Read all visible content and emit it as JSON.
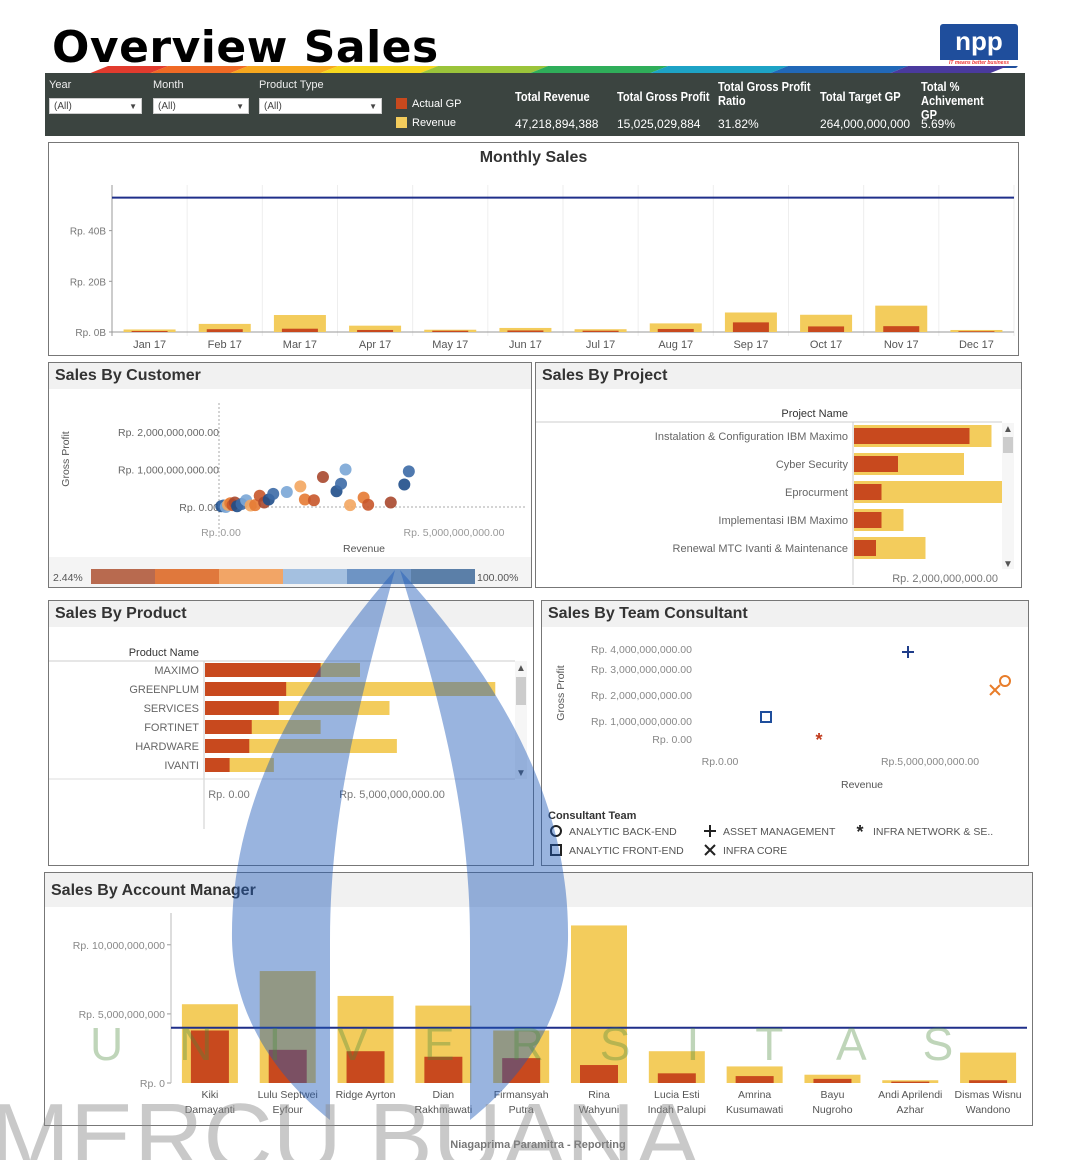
{
  "header": {
    "title": "Overview Sales",
    "logo_text": "npp",
    "logo_tagline": "IT means better business"
  },
  "filters": {
    "year": {
      "label": "Year",
      "value": "(All)"
    },
    "month": {
      "label": "Month",
      "value": "(All)"
    },
    "product_type": {
      "label": "Product Type",
      "value": "(All)"
    },
    "legend": [
      {
        "label": "Actual GP",
        "color": "#c8491e"
      },
      {
        "label": "Revenue",
        "color": "#f3cc5c"
      }
    ]
  },
  "kpis": [
    {
      "label": "Total Revenue",
      "value": "47,218,894,388"
    },
    {
      "label": "Total Gross Profit",
      "value": "15,025,029,884"
    },
    {
      "label": "Total Gross Profit Ratio",
      "value": "31.82%"
    },
    {
      "label": "Total Target GP",
      "value": "264,000,000,000"
    },
    {
      "label": "Total % Achivement GP",
      "value": "5.69%"
    }
  ],
  "monthly_sales": {
    "title": "Monthly Sales",
    "y_ticks": [
      "Rp. 40B",
      "Rp. 20B",
      "Rp. 0B"
    ],
    "chart_data": {
      "type": "bar",
      "categories": [
        "Jan 17",
        "Feb 17",
        "Mar 17",
        "Apr 17",
        "May 17",
        "Jun 17",
        "Jul 17",
        "Aug 17",
        "Sep 17",
        "Oct 17",
        "Nov 17",
        "Dec 17"
      ],
      "series": [
        {
          "name": "Revenue",
          "values": [
            1.0,
            3.2,
            6.7,
            2.5,
            0.9,
            1.6,
            1.1,
            3.4,
            7.7,
            6.8,
            10.4,
            0.8
          ]
        },
        {
          "name": "Actual GP",
          "values": [
            0.4,
            1.1,
            1.3,
            0.8,
            0.5,
            0.6,
            0.5,
            1.2,
            3.8,
            2.2,
            2.3,
            0.3
          ]
        }
      ],
      "target": 53,
      "ylim": [
        0,
        58
      ]
    }
  },
  "sales_by_customer": {
    "title": "Sales By Customer",
    "y_label": "Gross Profit",
    "x_label": "Revenue",
    "y_ticks": [
      "Rp. 2,000,000,000.00",
      "Rp. 1,000,000,000.00",
      "Rp. 0.00"
    ],
    "x_ticks": [
      "Rp. 0.00",
      "Rp. 5,000,000,000.00"
    ],
    "color_min": "2.44%",
    "color_max": "100.00%",
    "chart_data": {
      "type": "scatter",
      "points": [
        [
          0.05,
          0.02
        ],
        [
          0.1,
          0.04
        ],
        [
          0.15,
          0.0
        ],
        [
          0.2,
          0.06
        ],
        [
          0.25,
          0.1
        ],
        [
          0.3,
          0.05
        ],
        [
          0.35,
          0.12
        ],
        [
          0.4,
          0.02
        ],
        [
          0.5,
          0.08
        ],
        [
          0.6,
          0.18
        ],
        [
          0.7,
          0.04
        ],
        [
          0.8,
          0.05
        ],
        [
          0.9,
          0.3
        ],
        [
          1.0,
          0.12
        ],
        [
          1.1,
          0.2
        ],
        [
          1.2,
          0.35
        ],
        [
          1.5,
          0.4
        ],
        [
          1.8,
          0.55
        ],
        [
          1.9,
          0.2
        ],
        [
          2.1,
          0.18
        ],
        [
          2.3,
          0.8
        ],
        [
          2.6,
          0.42
        ],
        [
          2.7,
          0.62
        ],
        [
          2.8,
          1.0
        ],
        [
          2.9,
          0.05
        ],
        [
          3.2,
          0.25
        ],
        [
          3.3,
          0.06
        ],
        [
          3.8,
          0.12
        ],
        [
          4.1,
          0.6
        ],
        [
          4.2,
          0.95
        ],
        [
          5.0,
          3.5
        ],
        [
          8.2,
          2.3
        ],
        [
          9.4,
          0.45
        ],
        [
          9.7,
          2.25
        ]
      ]
    }
  },
  "sales_by_project": {
    "title": "Sales By Project",
    "header": "Project Name",
    "x_tick": "Rp. 2,000,000,000.00",
    "chart_data": {
      "type": "bar",
      "categories": [
        "Instalation & Configuration IBM Maximo",
        "Cyber Security",
        "Eprocurment",
        "Implementasi IBM Maximo",
        "Renewal MTC Ivanti & Maintenance"
      ],
      "series": [
        {
          "name": "Revenue",
          "values": [
            2.5,
            2.0,
            2.7,
            0.9,
            1.3
          ]
        },
        {
          "name": "Actual GP",
          "values": [
            2.1,
            0.8,
            0.5,
            0.5,
            0.4
          ]
        }
      ]
    }
  },
  "sales_by_product": {
    "title": "Sales By Product",
    "header": "Product Name",
    "x_ticks": [
      "Rp. 0.00",
      "Rp. 5,000,000,000.00"
    ],
    "chart_data": {
      "type": "bar",
      "categories": [
        "MAXIMO",
        "GREENPLUM",
        "SERVICES",
        "FORTINET",
        "HARDWARE",
        "IVANTI"
      ],
      "series": [
        {
          "name": "Revenue",
          "values": [
            6.3,
            11.8,
            7.5,
            4.7,
            7.8,
            2.8
          ]
        },
        {
          "name": "Actual GP",
          "values": [
            4.7,
            3.3,
            3.0,
            1.9,
            1.8,
            1.0
          ]
        }
      ]
    }
  },
  "sales_by_team": {
    "title": "Sales By Team Consultant",
    "y_label": "Gross Profit",
    "x_label": "Revenue",
    "y_ticks": [
      "Rp. 4,000,000,000.00",
      "Rp. 3,000,000,000.00",
      "Rp. 2,000,000,000.00",
      "Rp. 1,000,000,000.00",
      "Rp. 0.00"
    ],
    "x_ticks": [
      "Rp.0.00",
      "Rp.5,000,000,000.00"
    ],
    "legend_title": "Consultant Team",
    "chart_data": {
      "type": "scatter",
      "series": [
        {
          "name": "ANALYTIC BACK-END",
          "marker": "circle",
          "color": "#e87d2a",
          "x": 8.0,
          "y": 2.3
        },
        {
          "name": "ASSET MANAGEMENT",
          "marker": "plus",
          "color": "#1f3d8a",
          "x": 5.4,
          "y": 3.5
        },
        {
          "name": "INFRA NETWORK & SE..",
          "marker": "star",
          "color": "#c0391b",
          "x": 2.8,
          "y": 0.05
        },
        {
          "name": "ANALYTIC FRONT-END",
          "marker": "square",
          "color": "#1f4e9c",
          "x": 1.3,
          "y": 0.8
        },
        {
          "name": "INFRA CORE",
          "marker": "x",
          "color": "#e87d2a",
          "x": 7.7,
          "y": 1.85
        }
      ]
    }
  },
  "sales_by_am": {
    "title": "Sales By Account Manager",
    "y_ticks": [
      "Rp. 10,000,000,000",
      "Rp. 5,000,000,000",
      "Rp. 0"
    ],
    "chart_data": {
      "type": "bar",
      "categories": [
        "Kiki Damayanti",
        "Lulu Septwei Eyfour",
        "Ridge Ayrton",
        "Dian Rakhmawati",
        "Firmansyah Putra",
        "Rina Wahyuni",
        "Lucia Esti Indah Palupi",
        "Amrina Kusumawati",
        "Bayu Nugroho",
        "Andi Aprilendi Azhar",
        "Dismas Wisnu Wandono"
      ],
      "series": [
        {
          "name": "Revenue",
          "values": [
            5.7,
            8.1,
            6.3,
            5.6,
            3.8,
            11.4,
            2.3,
            1.2,
            0.6,
            0.2,
            2.2
          ]
        },
        {
          "name": "Actual GP",
          "values": [
            3.8,
            2.4,
            2.3,
            1.9,
            1.8,
            1.3,
            0.7,
            0.5,
            0.3,
            0.1,
            0.2
          ]
        }
      ],
      "target": 4.0,
      "ylim": [
        0,
        12.3
      ]
    }
  },
  "footer": {
    "text": "Niagaprima Paramitra - Reporting"
  },
  "watermark": {
    "text": "UNIVERSITAS",
    "brand": "MERCU BUANA"
  }
}
